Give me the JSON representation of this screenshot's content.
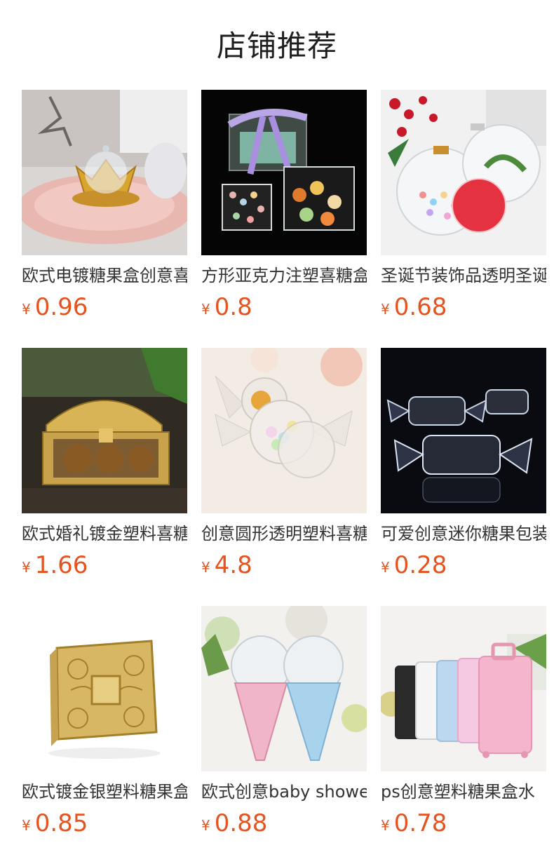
{
  "header": {
    "title": "店铺推荐"
  },
  "currency_symbol": "¥",
  "products": [
    {
      "name": "欧式电镀糖果盒创意喜糖盒",
      "price": "0.96",
      "image": "gold-crown-candy-box"
    },
    {
      "name": "方形亚克力注塑喜糖盒",
      "price": "0.8",
      "image": "square-acrylic-boxes"
    },
    {
      "name": "圣诞节装饰品透明圣诞球",
      "price": "0.68",
      "image": "christmas-ornament-balls"
    },
    {
      "name": "欧式婚礼镀金塑料喜糖盒",
      "price": "1.66",
      "image": "gold-treasure-chest"
    },
    {
      "name": "创意圆形透明塑料喜糖盒",
      "price": "4.8",
      "image": "round-candy-shaped-boxes"
    },
    {
      "name": "可爱创意迷你糖果包装盒",
      "price": "0.28",
      "image": "clear-candy-shaped-boxes"
    },
    {
      "name": "欧式镀金银塑料糖果盒",
      "price": "0.85",
      "image": "gold-filigree-box"
    },
    {
      "name": "欧式创意baby shower",
      "price": "0.88",
      "image": "ice-cream-cone-boxes"
    },
    {
      "name": "ps创意塑料糖果盒水",
      "price": "0.78",
      "image": "mini-suitcase-boxes"
    }
  ]
}
